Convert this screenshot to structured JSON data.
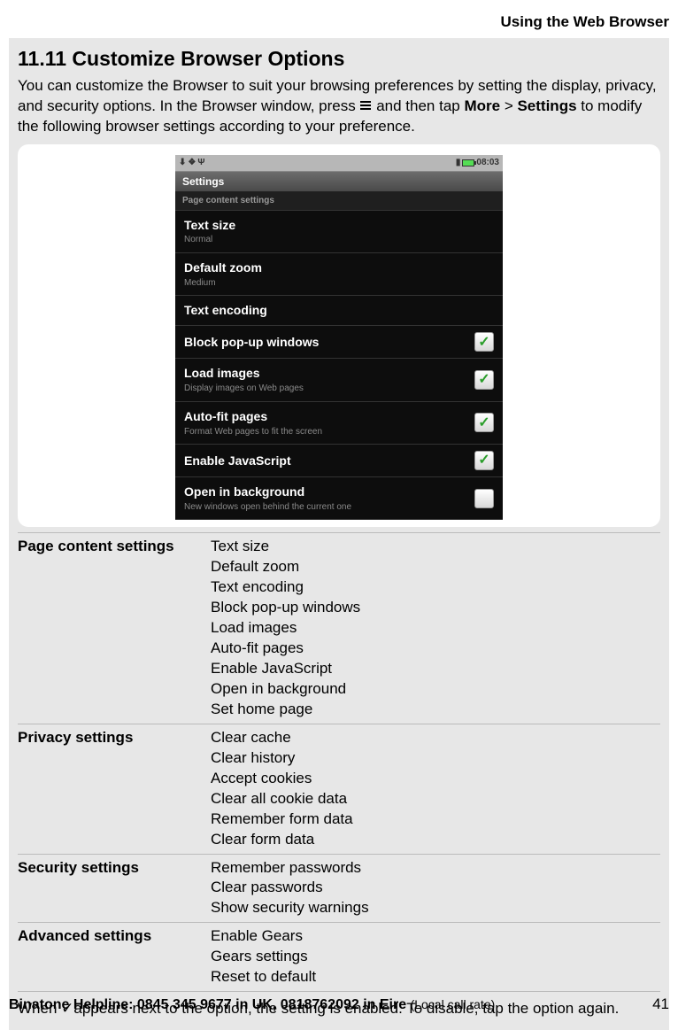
{
  "header": "Using the Web Browser",
  "section_title": "11.11 Customize Browser Options",
  "intro_part1": "You can customize the Browser to suit your browsing preferences by setting the display, privacy, and security options. In the Browser window, press ",
  "intro_part2": " and then tap ",
  "intro_more": "More",
  "intro_gt": " > ",
  "intro_settings": "Settings",
  "intro_part3": " to modify the following browser settings according to your preference.",
  "phone": {
    "status_time": "08:03",
    "title": "Settings",
    "subheader": "Page content settings",
    "rows": [
      {
        "main": "Text size",
        "sub": "Normal",
        "check": null
      },
      {
        "main": "Default zoom",
        "sub": "Medium",
        "check": null
      },
      {
        "main": "Text encoding",
        "sub": "",
        "check": null
      },
      {
        "main": "Block pop-up windows",
        "sub": "",
        "check": true
      },
      {
        "main": "Load images",
        "sub": "Display images on Web pages",
        "check": true
      },
      {
        "main": "Auto-fit pages",
        "sub": "Format Web pages to fit the screen",
        "check": true
      },
      {
        "main": "Enable JavaScript",
        "sub": "",
        "check": true
      },
      {
        "main": "Open in background",
        "sub": "New windows open behind the current one",
        "check": false
      }
    ]
  },
  "table": [
    {
      "label": "Page content settings",
      "items": [
        "Text size",
        "Default zoom",
        "Text encoding",
        "Block pop-up windows",
        "Load images",
        "Auto-fit pages",
        "Enable JavaScript",
        "Open in background",
        "Set home page"
      ]
    },
    {
      "label": "Privacy settings",
      "items": [
        "Clear cache",
        "Clear history",
        "Accept cookies",
        "Clear all cookie data",
        "Remember form data",
        "Clear form data"
      ]
    },
    {
      "label": "Security settings",
      "items": [
        "Remember passwords",
        "Clear passwords",
        "Show security warnings"
      ]
    },
    {
      "label": "Advanced settings",
      "items": [
        "Enable Gears",
        "Gears settings",
        "Reset to default"
      ]
    }
  ],
  "note_prefix": "When ",
  "note_check": "✓",
  "note_suffix": "appears next to the option, the setting is enabled. To disable, tap the option again.",
  "footer_left_bold": "Binatone Helpline: 0845 345 9677 in UK, 0818762092 in Eire ",
  "footer_left_light": "(Local call rate)",
  "footer_right": "41"
}
